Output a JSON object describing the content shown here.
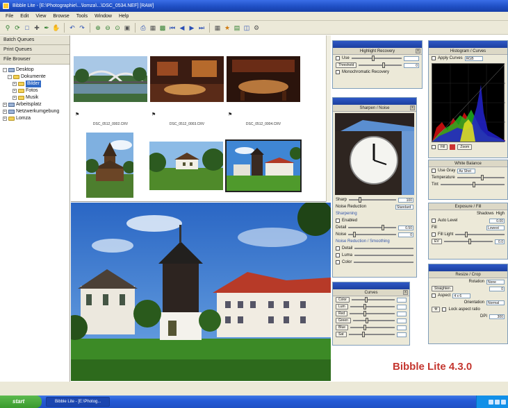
{
  "window": {
    "title": "Bibble Lite - [E:\\Photographie\\...\\lomza\\...\\DSC_0534.NEF] [RAW]"
  },
  "menu": [
    "File",
    "Edit",
    "View",
    "Browse",
    "Tools",
    "Window",
    "Help"
  ],
  "toolbar": {
    "icons": [
      "zoom-icon",
      "rotate-icon",
      "crop-icon",
      "select-icon",
      "eyedropper-icon",
      "hand-icon",
      "first-icon",
      "prev-icon",
      "next-icon",
      "last-icon",
      "grid-icon",
      "view-icon"
    ]
  },
  "left_panel": {
    "tabs": [
      "Batch Queues",
      "Print Queues",
      "File Browser"
    ],
    "tree": [
      {
        "label": "Desktop",
        "expander": "-",
        "type": "drive",
        "indent": 0
      },
      {
        "label": "Dokumente",
        "expander": "-",
        "type": "folder",
        "indent": 1
      },
      {
        "label": "Bilder",
        "expander": "+",
        "type": "folder",
        "indent": 2,
        "selected": true
      },
      {
        "label": "Fotos",
        "expander": "+",
        "type": "folder",
        "indent": 2
      },
      {
        "label": "Musik",
        "expander": "+",
        "type": "folder",
        "indent": 2
      },
      {
        "label": "Arbeitsplatz",
        "expander": "+",
        "type": "drive",
        "indent": 0
      },
      {
        "label": "Netzwerkumgebung",
        "expander": "+",
        "type": "drive",
        "indent": 0
      },
      {
        "label": "Lomza",
        "expander": "+",
        "type": "folder",
        "indent": 0
      }
    ]
  },
  "thumbnails": {
    "captions": [
      "DSC_0512_0002.CRV",
      "DSC_0512_0003.CRV",
      "DSC_0512_0004.CRV"
    ]
  },
  "panels": {
    "highlight_recovery": {
      "title": "Highlight Recovery",
      "rows": [
        {
          "label": "Use",
          "value": ""
        },
        {
          "label": "Threshold",
          "value": "0"
        }
      ],
      "checkbox": "Monochromatic Recovery"
    },
    "sharpen": {
      "title": "Sharpen / Noise",
      "rows": [
        {
          "label": "Sharp",
          "value": "100"
        },
        {
          "label": "Noise",
          "value": "100"
        }
      ],
      "noise_reduction_label": "Noise Reduction",
      "nr_mode": "Standard",
      "sections": [
        "Sharpening",
        "Enabled",
        "Noise Reduction / Smoothing"
      ],
      "sub_rows": [
        {
          "label": "Detail",
          "value": "0.50"
        },
        {
          "label": "Noise",
          "value": "0"
        }
      ],
      "nr_checks": [
        "Detail",
        "Luma",
        "Color"
      ]
    },
    "curves": {
      "title": "Curves",
      "rows": [
        "Color",
        "Lum",
        "Red",
        "Green",
        "Blue",
        "Sat"
      ]
    },
    "histogram": {
      "title": "Histogram / Curves",
      "apply_label": "Apply Curves",
      "mode": "RGB",
      "controls": [
        "Fill",
        "Zoom"
      ]
    },
    "white_balance": {
      "title": "White Balance",
      "rows": [
        {
          "label": "Use Gray",
          "value": "As Shot"
        },
        {
          "label": "Temperature",
          "value": ""
        },
        {
          "label": "Tint",
          "value": ""
        }
      ]
    },
    "exposure": {
      "title": "Exposure / Fill",
      "rows": [
        {
          "label": "Shadows",
          "value": "High"
        },
        {
          "label": "Auto Level",
          "value": "0.00"
        },
        {
          "label": "Fill",
          "value": "Lowest"
        },
        {
          "label": "Fill Light",
          "value": ""
        },
        {
          "label": "EV",
          "value": "0.0"
        }
      ]
    },
    "resize": {
      "title": "Resize / Crop",
      "rows": [
        {
          "label": "Rotation",
          "value": "None"
        },
        {
          "label": "Straighten",
          "value": "0"
        },
        {
          "label": "Aspect",
          "value": "4 x 6"
        },
        {
          "label": "Orientation",
          "value": "Normal"
        },
        {
          "label": "Lock aspect ratio",
          "value": ""
        },
        {
          "label": "DPI",
          "value": "300"
        }
      ]
    }
  },
  "overlay": {
    "watermark": "Bibble Lite 4.3.0",
    "watermark_color": "#c4362f"
  },
  "taskbar": {
    "start_label": "start",
    "task_label": "Bibble Lite - [E:\\Photog..."
  }
}
